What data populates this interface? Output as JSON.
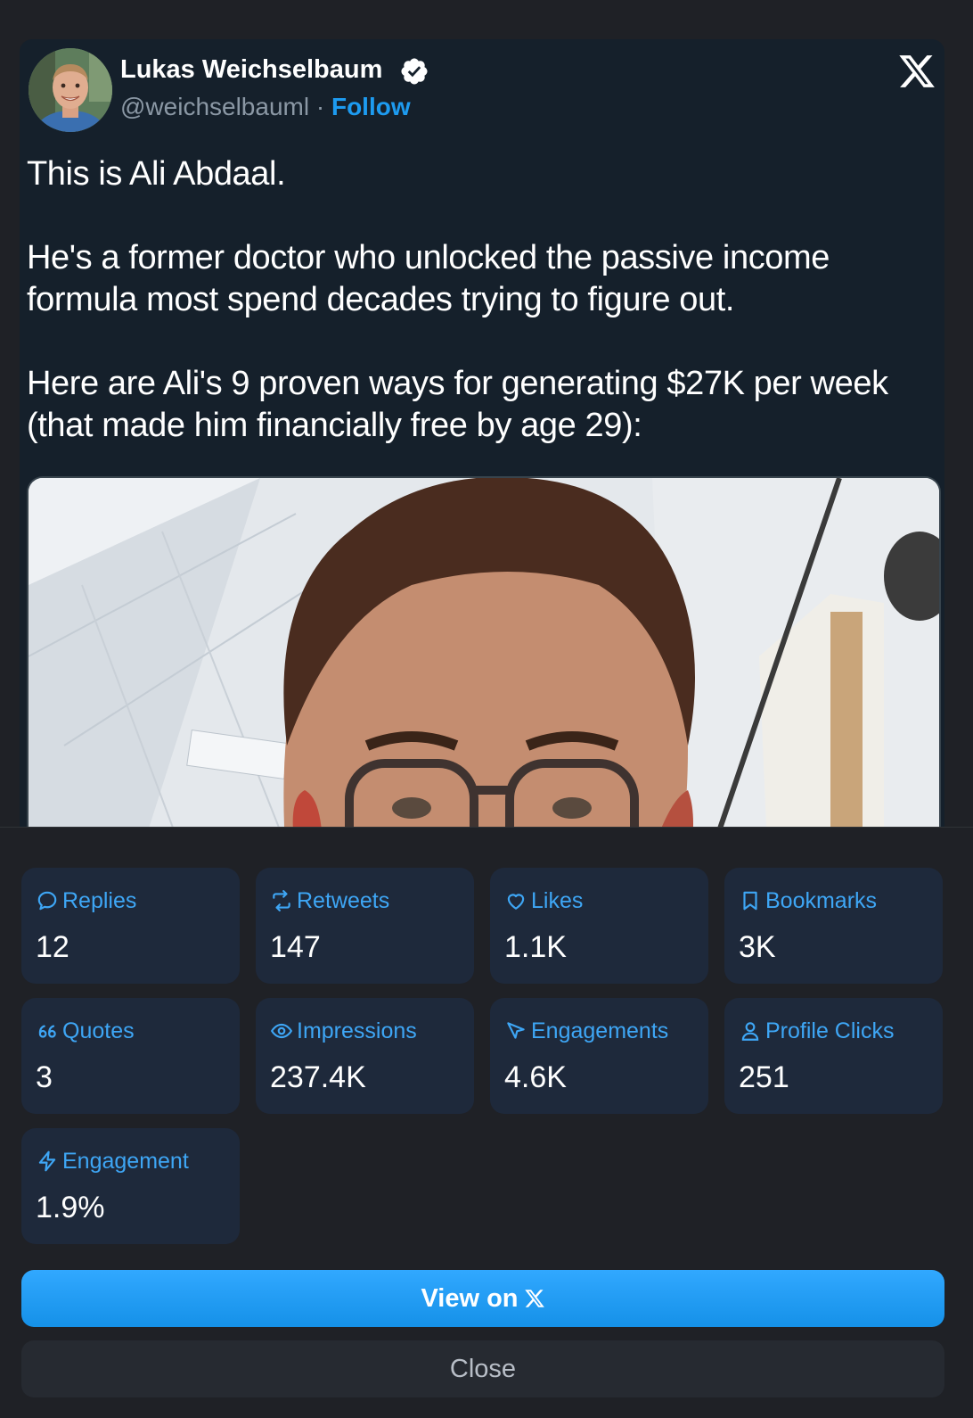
{
  "tweet": {
    "author_name": "Lukas Weichselbaum",
    "handle": "@weichselbauml",
    "separator": "·",
    "follow_label": "Follow",
    "paragraphs": [
      "This is Ali Abdaal.",
      "He's a former doctor who unlocked the passive income formula most spend decades trying to figure out.",
      "Here are Ali's 9 proven ways for generating $27K per week (that made him financially free by age 29):"
    ]
  },
  "stats": [
    {
      "label": "Replies",
      "value": "12",
      "icon": "reply-icon"
    },
    {
      "label": "Retweets",
      "value": "147",
      "icon": "retweet-icon"
    },
    {
      "label": "Likes",
      "value": "1.1K",
      "icon": "heart-icon"
    },
    {
      "label": "Bookmarks",
      "value": "3K",
      "icon": "bookmark-icon"
    },
    {
      "label": "Quotes",
      "value": "3",
      "icon": "quote-icon"
    },
    {
      "label": "Impressions",
      "value": "237.4K",
      "icon": "eye-icon"
    },
    {
      "label": "Engagements",
      "value": "4.6K",
      "icon": "cursor-icon"
    },
    {
      "label": "Profile Clicks",
      "value": "251",
      "icon": "user-icon"
    },
    {
      "label": "Engagement",
      "value": "1.9%",
      "icon": "lightning-icon"
    }
  ],
  "actions": {
    "view_label": "View on",
    "close_label": "Close"
  },
  "colors": {
    "accent": "#1d9bf0",
    "card_bg": "#15202b",
    "stat_bg": "#1e293b",
    "page_bg": "#1f2126"
  }
}
